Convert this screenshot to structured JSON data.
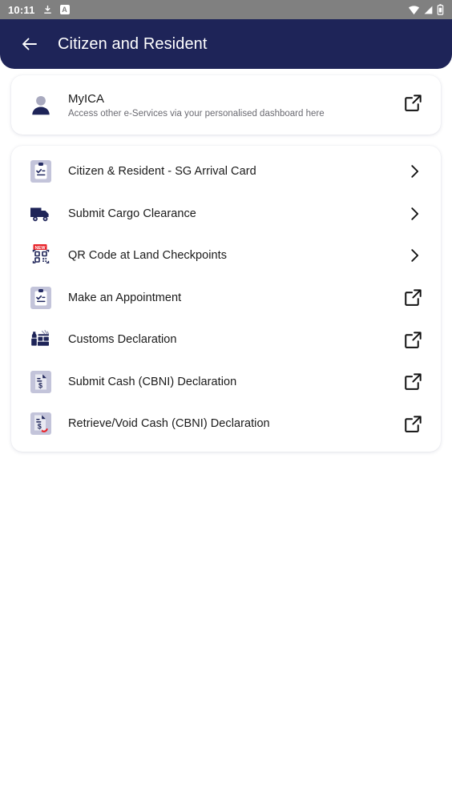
{
  "status_bar": {
    "time": "10:11",
    "left_icons": [
      "download-icon",
      "app-badge-a"
    ],
    "app_badge_text": "A",
    "right_icons": [
      "wifi-icon",
      "cellular-signal-icon",
      "battery-icon"
    ],
    "background_color": "#808080"
  },
  "header": {
    "title": "Citizen and Resident",
    "back_icon": "back-arrow-icon",
    "background_color": "#1E2458",
    "text_color": "#FFFFFF"
  },
  "myica_card": {
    "icon": "person-avatar-icon",
    "title": "MyICA",
    "subtitle": "Access other e-Services via your personalised dashboard here",
    "action_icon": "external-link-icon"
  },
  "services": {
    "items": [
      {
        "label": "Citizen & Resident - SG Arrival Card",
        "icon": "clipboard-check-icon",
        "action_icon": "chevron-right-icon",
        "badge": ""
      },
      {
        "label": "Submit Cargo Clearance",
        "icon": "cargo-truck-icon",
        "action_icon": "chevron-right-icon",
        "badge": ""
      },
      {
        "label": "QR Code at Land Checkpoints",
        "icon": "qr-code-icon",
        "action_icon": "chevron-right-icon",
        "badge": "NEW"
      },
      {
        "label": "Make an Appointment",
        "icon": "clipboard-check-icon",
        "action_icon": "external-link-icon",
        "badge": ""
      },
      {
        "label": "Customs Declaration",
        "icon": "customs-goods-icon",
        "action_icon": "external-link-icon",
        "badge": ""
      },
      {
        "label": "Submit Cash (CBNI) Declaration",
        "icon": "cash-document-icon",
        "action_icon": "external-link-icon",
        "badge": ""
      },
      {
        "label": "Retrieve/Void Cash (CBNI) Declaration",
        "icon": "cash-document-return-icon",
        "action_icon": "external-link-icon",
        "badge": ""
      }
    ]
  },
  "colors": {
    "navy": "#1E2458",
    "page_background": "#FFFFFF",
    "card_background": "#FFFFFF",
    "icon_tile": "#C3C4DA",
    "badge_red": "#E8232A",
    "status_bar": "#808080"
  }
}
